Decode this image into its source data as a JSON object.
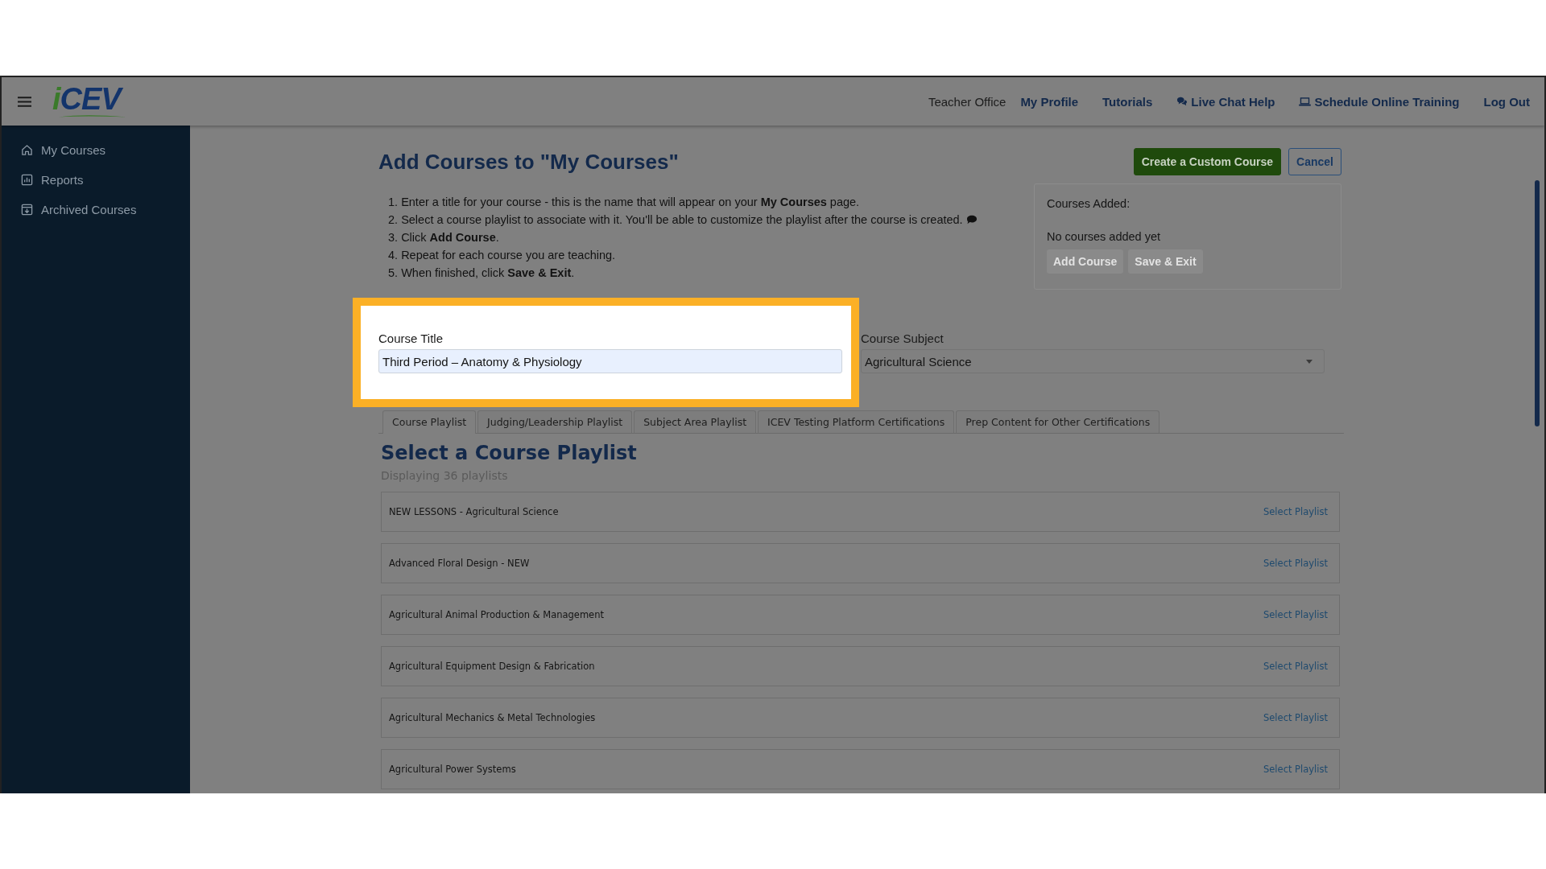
{
  "header": {
    "logo": {
      "accent": "i",
      "text": "CEV"
    },
    "nav": [
      {
        "label": "Teacher Office",
        "kind": "plain"
      },
      {
        "label": "My Profile",
        "kind": "bold"
      },
      {
        "label": "Tutorials",
        "kind": "bold"
      },
      {
        "label": "Live Chat Help",
        "kind": "chat"
      },
      {
        "label": "Schedule Online Training",
        "kind": "laptop"
      },
      {
        "label": "Log Out",
        "kind": "bold"
      }
    ]
  },
  "sidebar": {
    "items": [
      {
        "label": "My Courses",
        "kind": "home"
      },
      {
        "label": "Reports",
        "kind": "reports"
      },
      {
        "label": "Archived Courses",
        "kind": "archive"
      }
    ]
  },
  "page": {
    "title": "Add Courses to \"My Courses\"",
    "buttons": [
      {
        "label": "Create a Custom Course",
        "kind": "primary"
      },
      {
        "label": "Cancel",
        "kind": "outline"
      }
    ],
    "instructions": [
      {
        "number": "1.",
        "text": "Enter a title for your course - this is the name that will appear on your **My Courses** page.",
        "kind": "plain"
      },
      {
        "number": "2.",
        "text": "Select a course playlist to associate with it. You'll be able to customize the playlist after the course is created.",
        "kind": "note"
      },
      {
        "number": "3.",
        "text": "Click **Add Course**.",
        "kind": "plain"
      },
      {
        "number": "4.",
        "text": "Repeat for each course you are teaching.",
        "kind": "plain"
      },
      {
        "number": "5.",
        "text": "When finished, click **Save & Exit**.",
        "kind": "plain"
      }
    ],
    "courses_added": {
      "title": "Courses Added:",
      "empty": "No courses added yet",
      "buttons": [
        {
          "label": "Add Course",
          "disabled": true
        },
        {
          "label": "Save & Exit",
          "disabled": true
        }
      ]
    },
    "course_title": {
      "label": "Course Title",
      "value": "Third Period – Anatomy & Physiology",
      "highlighted": true
    },
    "course_subject": {
      "label": "Course Subject",
      "value": "Agricultural Science"
    },
    "tabs": [
      {
        "label": "Course Playlist",
        "selected": true
      },
      {
        "label": "Judging/Leadership Playlist",
        "selected": false
      },
      {
        "label": "Subject Area Playlist",
        "selected": false
      },
      {
        "label": "ICEV Testing Platform Certifications",
        "selected": false
      },
      {
        "label": "Prep Content for Other Certifications",
        "selected": false
      }
    ],
    "playlist": {
      "title": "Select a Course Playlist",
      "count": "Displaying 36 playlists",
      "rows": [
        {
          "name": "NEW LESSONS - Agricultural Science",
          "action": "Select Playlist"
        },
        {
          "name": "Advanced Floral Design - NEW",
          "action": "Select Playlist"
        },
        {
          "name": "Agricultural Animal Production & Management",
          "action": "Select Playlist"
        },
        {
          "name": "Agricultural Equipment Design & Fabrication",
          "action": "Select Playlist"
        },
        {
          "name": "Agricultural Mechanics & Metal Technologies",
          "action": "Select Playlist"
        },
        {
          "name": "Agricultural Power Systems",
          "action": "Select Playlist"
        }
      ]
    }
  }
}
